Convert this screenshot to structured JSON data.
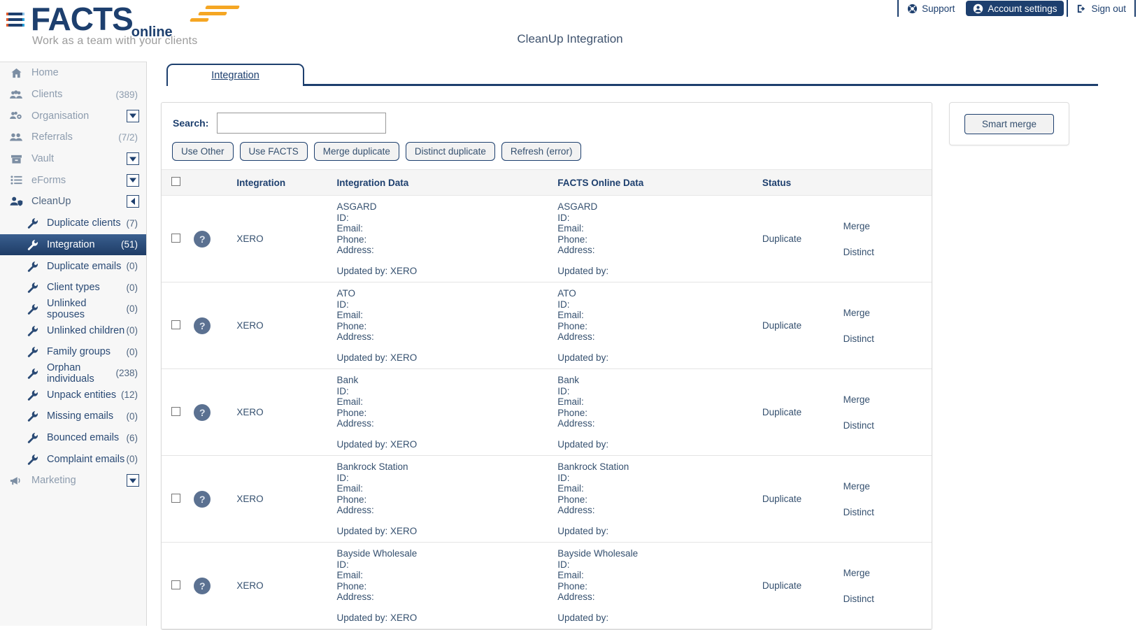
{
  "header": {
    "page_title": "CleanUp Integration",
    "logo_main": "FACTS",
    "logo_suffix": "online",
    "tagline": "Work as a team with your clients",
    "right_items": [
      {
        "label": "Support",
        "icon": "life-ring-icon",
        "active": false
      },
      {
        "label": "Account settings",
        "icon": "user-circle-icon",
        "active": true
      },
      {
        "label": "Sign out",
        "icon": "sign-out-icon",
        "active": false
      }
    ]
  },
  "sidebar": {
    "items": [
      {
        "label": "Home",
        "count": "",
        "icon": "home-icon",
        "kind": "top",
        "selected": false,
        "muted": true
      },
      {
        "label": "Clients",
        "count": "(389)",
        "icon": "clients-icon",
        "kind": "top",
        "selected": false,
        "muted": true
      },
      {
        "label": "Organisation",
        "count": "",
        "icon": "organisation-icon",
        "kind": "top",
        "selected": false,
        "muted": true,
        "expander": "down"
      },
      {
        "label": "Referrals",
        "count": "(7/2)",
        "icon": "referrals-icon",
        "kind": "top",
        "selected": false,
        "muted": true
      },
      {
        "label": "Vault",
        "count": "",
        "icon": "vault-icon",
        "kind": "top",
        "selected": false,
        "muted": true,
        "expander": "down"
      },
      {
        "label": "eForms",
        "count": "",
        "icon": "eforms-icon",
        "kind": "top",
        "selected": false,
        "muted": true,
        "expander": "down"
      },
      {
        "label": "CleanUp",
        "count": "",
        "icon": "cleanup-icon",
        "kind": "top",
        "selected": false,
        "muted": false,
        "expander": "left"
      },
      {
        "label": "Duplicate clients",
        "count": "(7)",
        "icon": "wrench-icon",
        "kind": "sub",
        "selected": false
      },
      {
        "label": "Integration",
        "count": "(51)",
        "icon": "wrench-icon",
        "kind": "sub",
        "selected": true
      },
      {
        "label": "Duplicate emails",
        "count": "(0)",
        "icon": "wrench-icon",
        "kind": "sub",
        "selected": false
      },
      {
        "label": "Client types",
        "count": "(0)",
        "icon": "wrench-icon",
        "kind": "sub",
        "selected": false
      },
      {
        "label": "Unlinked spouses",
        "count": "(0)",
        "icon": "wrench-icon",
        "kind": "sub",
        "selected": false
      },
      {
        "label": "Unlinked children",
        "count": "(0)",
        "icon": "wrench-icon",
        "kind": "sub",
        "selected": false
      },
      {
        "label": "Family groups",
        "count": "(0)",
        "icon": "wrench-icon",
        "kind": "sub",
        "selected": false
      },
      {
        "label": "Orphan individuals",
        "count": "(238)",
        "icon": "wrench-icon",
        "kind": "sub",
        "selected": false
      },
      {
        "label": "Unpack entities",
        "count": "(12)",
        "icon": "wrench-icon",
        "kind": "sub",
        "selected": false
      },
      {
        "label": "Missing emails",
        "count": "(0)",
        "icon": "wrench-icon",
        "kind": "sub",
        "selected": false
      },
      {
        "label": "Bounced emails",
        "count": "(6)",
        "icon": "wrench-icon",
        "kind": "sub",
        "selected": false
      },
      {
        "label": "Complaint emails",
        "count": "(0)",
        "icon": "wrench-icon",
        "kind": "sub",
        "selected": false
      },
      {
        "label": "Marketing",
        "count": "",
        "icon": "megaphone-icon",
        "kind": "top",
        "selected": false,
        "muted": true,
        "expander": "down"
      }
    ]
  },
  "tabs": [
    {
      "label": "Integration",
      "active": true
    }
  ],
  "toolbar": {
    "search_label": "Search:",
    "search_value": "",
    "search_placeholder": "",
    "buttons": [
      {
        "label": "Use Other"
      },
      {
        "label": "Use FACTS"
      },
      {
        "label": "Merge duplicate"
      },
      {
        "label": "Distinct duplicate"
      },
      {
        "label": "Refresh (error)"
      }
    ]
  },
  "side_panel": {
    "smart_merge_label": "Smart merge"
  },
  "table": {
    "columns": [
      "",
      "",
      "Integration",
      "Integration Data",
      "FACTS Online Data",
      "Status",
      ""
    ],
    "field_labels": {
      "id": "ID:",
      "email": "Email:",
      "phone": "Phone:",
      "address": "Address:"
    },
    "rows": [
      {
        "integration": "XERO",
        "integration_data": {
          "name": "ASGARD",
          "id": "ID:",
          "email": "Email:",
          "phone": "Phone:",
          "address": "Address:",
          "updated_by": "Updated by: XERO"
        },
        "facts_data": {
          "name": "ASGARD",
          "id": "ID:",
          "email": "Email:",
          "phone": "Phone:",
          "address": "Address:",
          "updated_by": "Updated by:"
        },
        "status": "Duplicate",
        "actions": [
          "Merge",
          "Distinct"
        ]
      },
      {
        "integration": "XERO",
        "integration_data": {
          "name": "ATO",
          "id": "ID:",
          "email": "Email:",
          "phone": "Phone:",
          "address": "Address:",
          "updated_by": "Updated by: XERO"
        },
        "facts_data": {
          "name": "ATO",
          "id": "ID:",
          "email": "Email:",
          "phone": "Phone:",
          "address": "Address:",
          "updated_by": "Updated by:"
        },
        "status": "Duplicate",
        "actions": [
          "Merge",
          "Distinct"
        ]
      },
      {
        "integration": "XERO",
        "integration_data": {
          "name": "Bank",
          "id": "ID:",
          "email": "Email:",
          "phone": "Phone:",
          "address": "Address:",
          "updated_by": "Updated by: XERO"
        },
        "facts_data": {
          "name": "Bank",
          "id": "ID:",
          "email": "Email:",
          "phone": "Phone:",
          "address": "Address:",
          "updated_by": "Updated by:"
        },
        "status": "Duplicate",
        "actions": [
          "Merge",
          "Distinct"
        ]
      },
      {
        "integration": "XERO",
        "integration_data": {
          "name": "Bankrock Station",
          "id": "ID:",
          "email": "Email:",
          "phone": "Phone:",
          "address": "Address:",
          "updated_by": "Updated by: XERO"
        },
        "facts_data": {
          "name": "Bankrock Station",
          "id": "ID:",
          "email": "Email:",
          "phone": "Phone:",
          "address": "Address:",
          "updated_by": "Updated by:"
        },
        "status": "Duplicate",
        "actions": [
          "Merge",
          "Distinct"
        ]
      },
      {
        "integration": "XERO",
        "integration_data": {
          "name": "Bayside Wholesale",
          "id": "ID:",
          "email": "Email:",
          "phone": "Phone:",
          "address": "Address:",
          "updated_by": "Updated by: XERO"
        },
        "facts_data": {
          "name": "Bayside Wholesale",
          "id": "ID:",
          "email": "Email:",
          "phone": "Phone:",
          "address": "Address:",
          "updated_by": "Updated by:"
        },
        "status": "Duplicate",
        "actions": [
          "Merge",
          "Distinct"
        ]
      }
    ],
    "row_icon": "question-mark-icon"
  },
  "colors": {
    "brand_navy": "#1d3f6e",
    "accent_orange": "#f5a623",
    "text": "#35506f",
    "sidebar_bg": "#f7f7f7",
    "selected_nav": "#1e3c66"
  }
}
